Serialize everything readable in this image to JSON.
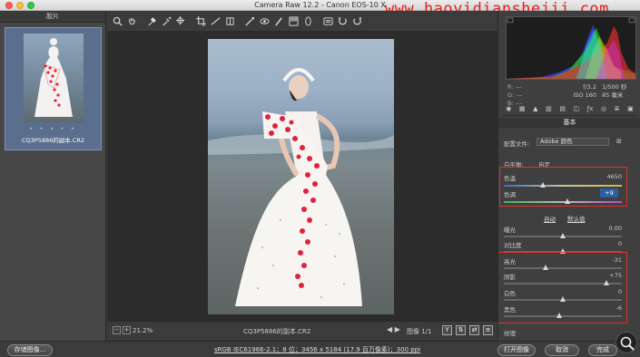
{
  "window": {
    "title": "Camera Raw 12.2 - Canon EOS-10 X"
  },
  "watermark": "www.haoyidianshejii.com",
  "filmstrip": {
    "header": "胶片",
    "thumb_name": "CQ3P5886的副本.CR2",
    "stars": "• • • • •"
  },
  "toolbar": {
    "tools": [
      "zoom-icon",
      "hand-icon",
      "white-balance-icon",
      "color-sampler-icon",
      "targeted-adjust-icon",
      "crop-icon",
      "straighten-icon",
      "transform-icon",
      "spot-removal-icon",
      "red-eye-icon",
      "adjustment-brush-icon",
      "graduated-filter-icon",
      "radial-filter-icon",
      "preferences-icon",
      "rotate-left-icon",
      "rotate-right-icon"
    ]
  },
  "canvas_footer": {
    "zoom": "21.2%",
    "filename": "CQ3P5886的副本.CR2",
    "image_count": "图像 1/1",
    "minus": "−",
    "plus": "+",
    "nav": "◀ ▶",
    "view_y": "Y"
  },
  "bottom": {
    "save_label": "存储图像...",
    "workflow_link": "sRGB IEC61966-2.1；8 位；3456 x 5184 (17.9 百万像素)；300 ppi",
    "open_label": "打开图像",
    "cancel_label": "取消",
    "done_label": "完成"
  },
  "histogram": {
    "r_label": "R:",
    "r_val": "---",
    "g_label": "G:",
    "g_val": "---",
    "b_label": "B:",
    "b_val": "---",
    "aperture": "f/3.2",
    "shutter": "1/500 秒",
    "iso": "ISO 160",
    "focal": "85 毫米"
  },
  "basic_panel": {
    "title": "基本",
    "profile_label": "配置文件:",
    "profile_value": "Adobe 颜色",
    "wb_label": "白平衡:",
    "wb_value": "自定",
    "auto_link": "自动",
    "default_link": "默认值",
    "sliders": {
      "temp": {
        "label": "色温",
        "value": "4650",
        "pos": 0.33
      },
      "tint": {
        "label": "色调",
        "value": "+9",
        "pos": 0.54
      },
      "exposure": {
        "label": "曝光",
        "value": "0.00",
        "pos": 0.5
      },
      "contrast": {
        "label": "对比度",
        "value": "0",
        "pos": 0.5
      },
      "highlights": {
        "label": "高光",
        "value": "-31",
        "pos": 0.35
      },
      "shadows": {
        "label": "阴影",
        "value": "+75",
        "pos": 0.87
      },
      "whites": {
        "label": "白色",
        "value": "0",
        "pos": 0.5
      },
      "blacks": {
        "label": "黑色",
        "value": "-6",
        "pos": 0.47
      },
      "texture": {
        "label": "纹理",
        "value": "",
        "pos": 0.5
      }
    }
  },
  "colors": {
    "accent_red": "#d9352c",
    "selection_blue": "#2b5fa8"
  }
}
